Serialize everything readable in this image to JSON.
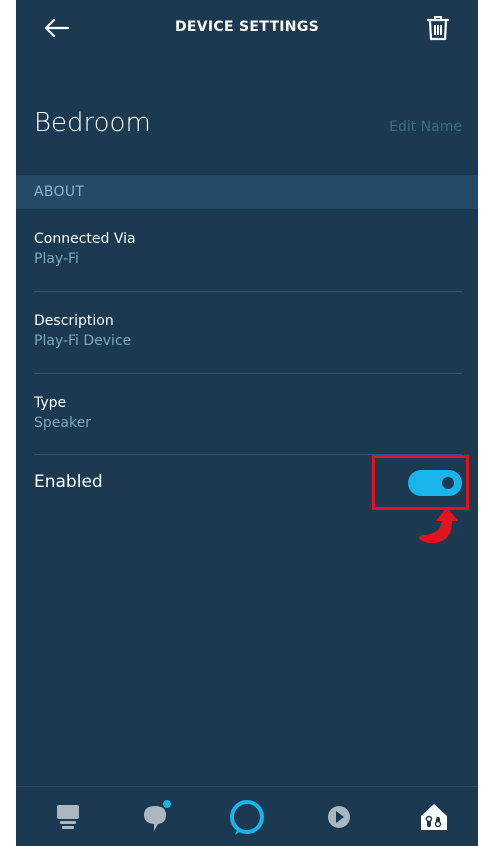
{
  "header": {
    "title": "DEVICE SETTINGS",
    "back_icon": "back-arrow-icon",
    "delete_icon": "trash-icon"
  },
  "device": {
    "name": "Bedroom",
    "edit_label": "Edit Name"
  },
  "about": {
    "header": "ABOUT",
    "items": [
      {
        "label": "Connected Via",
        "value": "Play-Fi"
      },
      {
        "label": "Description",
        "value": "Play-Fi Device"
      },
      {
        "label": "Type",
        "value": "Speaker"
      }
    ]
  },
  "enabled": {
    "label": "Enabled",
    "state": true
  },
  "annotation": {
    "box_color": "#e3121b",
    "arrow_icon": "curved-arrow-icon"
  },
  "bottom_nav": [
    {
      "icon": "devices-icon"
    },
    {
      "icon": "chat-icon"
    },
    {
      "icon": "alexa-icon"
    },
    {
      "icon": "play-icon"
    },
    {
      "icon": "smart-home-icon"
    }
  ],
  "colors": {
    "background": "#1b3a52",
    "accent": "#19b4ea",
    "section_header": "#234a66"
  }
}
